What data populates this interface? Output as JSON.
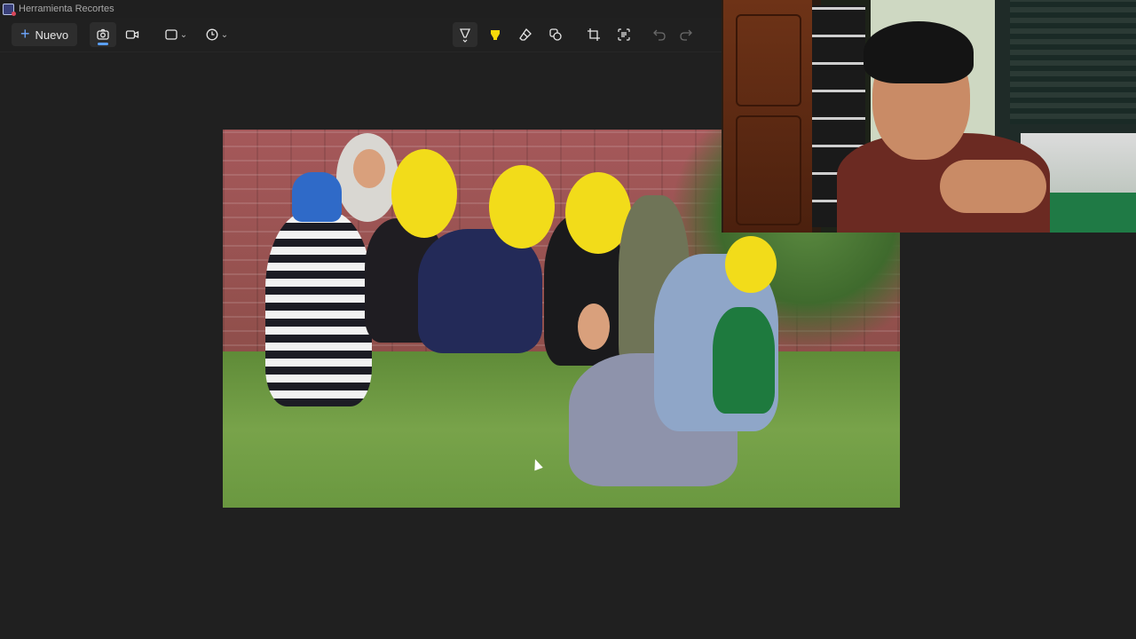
{
  "window": {
    "title": "Herramienta Recortes"
  },
  "toolbar": {
    "new_label": "Nuevo",
    "icons": {
      "new": "plus-icon",
      "photo_mode": "camera-icon",
      "video_mode": "video-camera-icon",
      "snip_shape": "rectangle-snip-icon",
      "delay": "timer-icon",
      "pen": "ballpoint-pen-icon",
      "highlighter": "highlighter-icon",
      "eraser": "eraser-icon",
      "shapes": "shapes-icon",
      "crop": "crop-icon",
      "text_actions": "text-actions-icon",
      "undo": "undo-icon",
      "redo": "redo-icon"
    }
  },
  "colors": {
    "background": "#202020",
    "accent": "#5aa0ff",
    "highlighter": "#f5d90a"
  }
}
